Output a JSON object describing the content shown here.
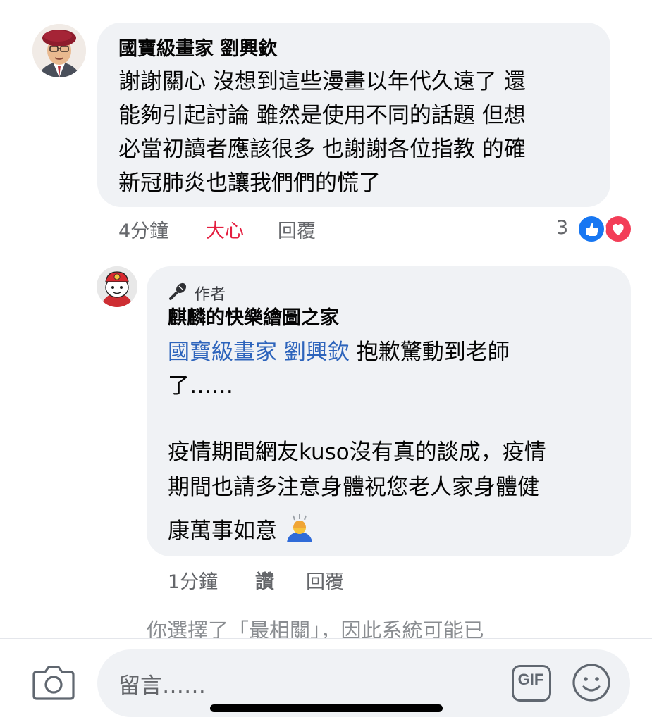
{
  "comment1": {
    "author": "國寶級畫家 劉興欽",
    "lines": [
      "謝謝關心 沒想到這些漫畫以年代久遠了 還",
      "能夠引起討論 雖然是使用不同的話題 但想",
      "必當初讀者應該很多 也謝謝各位指教 的確",
      "新冠肺炎也讓我們們的慌了"
    ],
    "time": "4分鐘",
    "reaction_label": "大心",
    "reply_label": "回覆",
    "reaction_count": "3",
    "reaction_icons": [
      "like-icon",
      "love-icon"
    ],
    "colors": {
      "like": "#1877f2",
      "love": "#f33e58",
      "love_text": "#e41e3f"
    }
  },
  "comment2": {
    "badge": "作者",
    "author": "麒麟的快樂繪圖之家",
    "mention": "國寶級畫家 劉興欽",
    "line1_rest": " 抱歉驚動到老師",
    "line2": "了……",
    "line3": "疫情期間網友kuso沒有真的談成，疫情",
    "line4": "期間也請多注意身體祝您老人家身體健",
    "line5": "康萬事如意",
    "emoji": "🙇",
    "time": "1分鐘",
    "like_label": "讚",
    "reply_label": "回覆",
    "colors": {
      "mention": "#2d64bc"
    }
  },
  "relevance_note": "你選擇了「最相關」，因此系統可能已",
  "composer": {
    "placeholder": "留言……",
    "camera_icon": "camera-icon",
    "gif_label": "GIF",
    "emoji_icon": "smiley-icon"
  }
}
